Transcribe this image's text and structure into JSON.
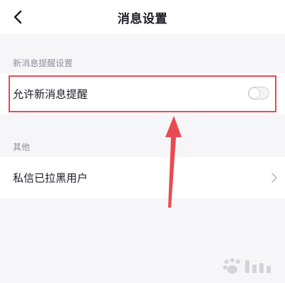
{
  "nav": {
    "title": "消息设置",
    "back_icon": "chevron-left-icon"
  },
  "sections": {
    "notification": {
      "header": "新消息提醒设置",
      "row_label": "允许新消息提醒",
      "toggle_on": false
    },
    "other": {
      "header": "其他",
      "row_label": "私信已拉黑用户",
      "row_icon": "chevron-right-icon"
    }
  },
  "colors": {
    "highlight": "#e94a52",
    "background": "#f6f6f9"
  }
}
